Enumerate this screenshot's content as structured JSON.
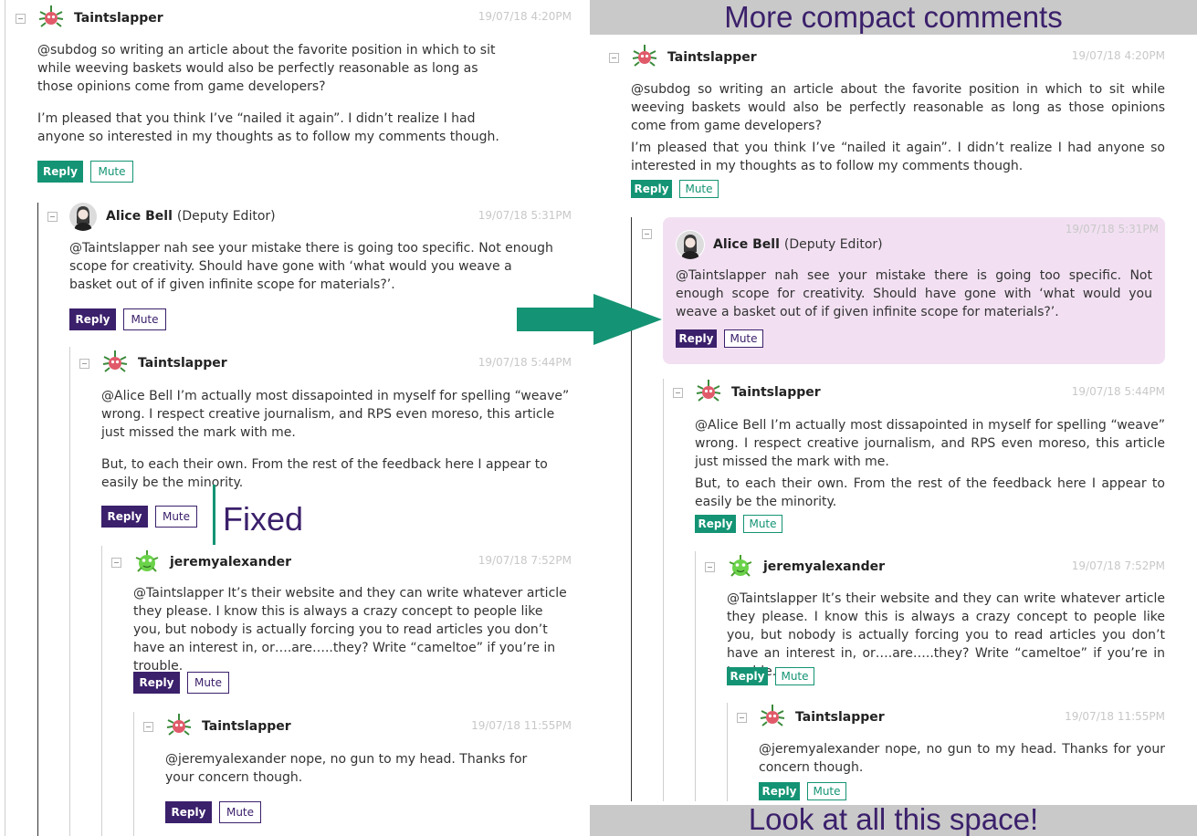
{
  "annotations": {
    "top_banner": "More compact comments",
    "bottom_banner": "Look at all this space!",
    "fixed_label": "Fixed",
    "arrow_icon": "right-arrow-icon"
  },
  "buttons": {
    "reply": "Reply",
    "mute": "Mute"
  },
  "colors": {
    "green": "#149474",
    "purple": "#3b206b",
    "highlight": "#f2e0f2",
    "banner": "#c9c9c9"
  },
  "comments": [
    {
      "author": "Taintslapper",
      "date": "19/07/18 4:20PM",
      "paragraphs": [
        "@subdog so writing an article about the favorite position in which to sit while weeving baskets would also be perfectly reasonable as long as those opinions come from game developers?",
        "I’m pleased that you think I’ve “nailed it again”. I didn’t realize I had anyone so interested in my thoughts as to follow my comments though."
      ]
    },
    {
      "author": "Alice Bell",
      "role": "(Deputy Editor)",
      "date": "19/07/18 5:31PM",
      "paragraphs": [
        "@Taintslapper nah see your mistake there is going too specific. Not enough scope for creativity. Should have gone with ‘what would you weave a basket out of if given infinite scope for materials?’."
      ]
    },
    {
      "author": "Taintslapper",
      "date": "19/07/18 5:44PM",
      "paragraphs": [
        "@Alice Bell I’m actually most dissapointed in myself for spelling “weave” wrong. I respect creative journalism, and RPS even moreso, this article just missed the mark with me.",
        "But, to each their own. From the rest of the feedback here I appear to easily be the minority."
      ]
    },
    {
      "author": "jeremyalexander",
      "date": "19/07/18 7:52PM",
      "paragraphs": [
        "@Taintslapper It’s their website and they can write whatever article they please. I know this is always a crazy concept to people like you, but nobody is actually forcing you to read articles you don’t have an interest in, or….are…..they? Write “cameltoe” if you’re in trouble."
      ]
    },
    {
      "author": "Taintslapper",
      "date": "19/07/18 11:55PM",
      "paragraphs": [
        "@jeremyalexander nope, no gun to my head. Thanks for your concern though."
      ]
    }
  ]
}
